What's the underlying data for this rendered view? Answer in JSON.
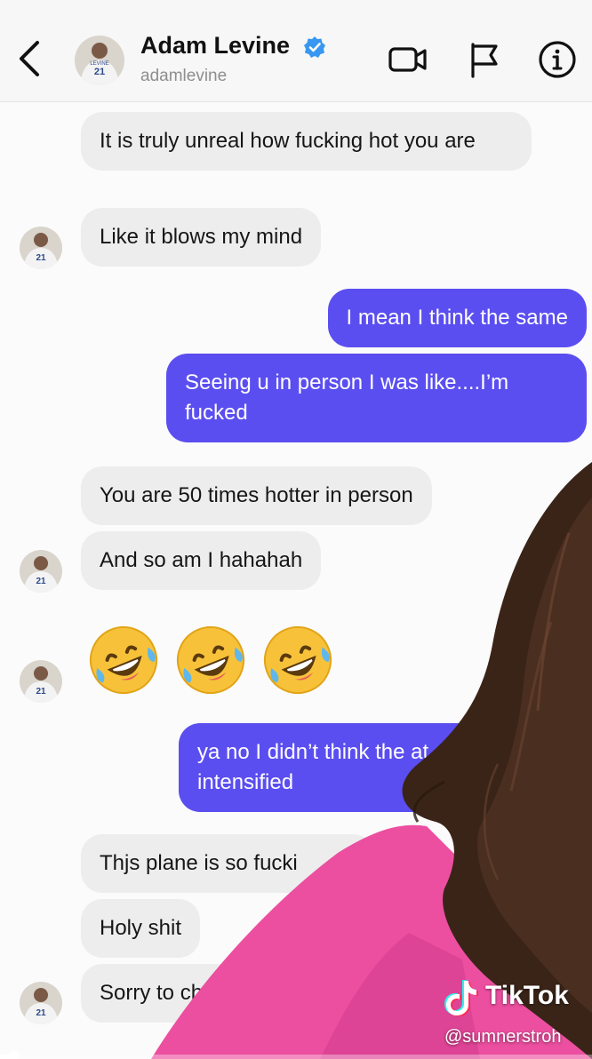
{
  "header": {
    "name": "Adam Levine",
    "handle": "adamlevine"
  },
  "messages": [
    {
      "from": "them",
      "text": "It is truly unreal how fucking hot you are"
    },
    {
      "from": "them",
      "text": "Like it blows my mind"
    },
    {
      "from": "me",
      "text": "I mean I think the same"
    },
    {
      "from": "me",
      "text": "Seeing u in person I was like....I’m fucked"
    },
    {
      "from": "them",
      "text": "You are 50 times hotter in person"
    },
    {
      "from": "them",
      "text": "And so am I hahahah"
    },
    {
      "from": "them",
      "text": "🤣🤣🤣"
    },
    {
      "from": "me",
      "text": "ya no I didn’t think the at could be intensified"
    },
    {
      "from": "them",
      "text": "Thjs plane is so fucki"
    },
    {
      "from": "them",
      "text": "Holy shit"
    },
    {
      "from": "them",
      "text": "Sorry to ch"
    }
  ],
  "emoji": {
    "name": "rolling-on-the-floor-laughing",
    "count": 3
  },
  "watermark": {
    "brand": "TikTok",
    "handle": "@sumnerstroh"
  },
  "video_progress": 0.03,
  "colors": {
    "outgoing_bubble": "#5b4ef0",
    "incoming_bubble": "#ededed",
    "verified": "#3897f0",
    "sweater": "#ec4fa0",
    "hair": "#3a2418"
  }
}
